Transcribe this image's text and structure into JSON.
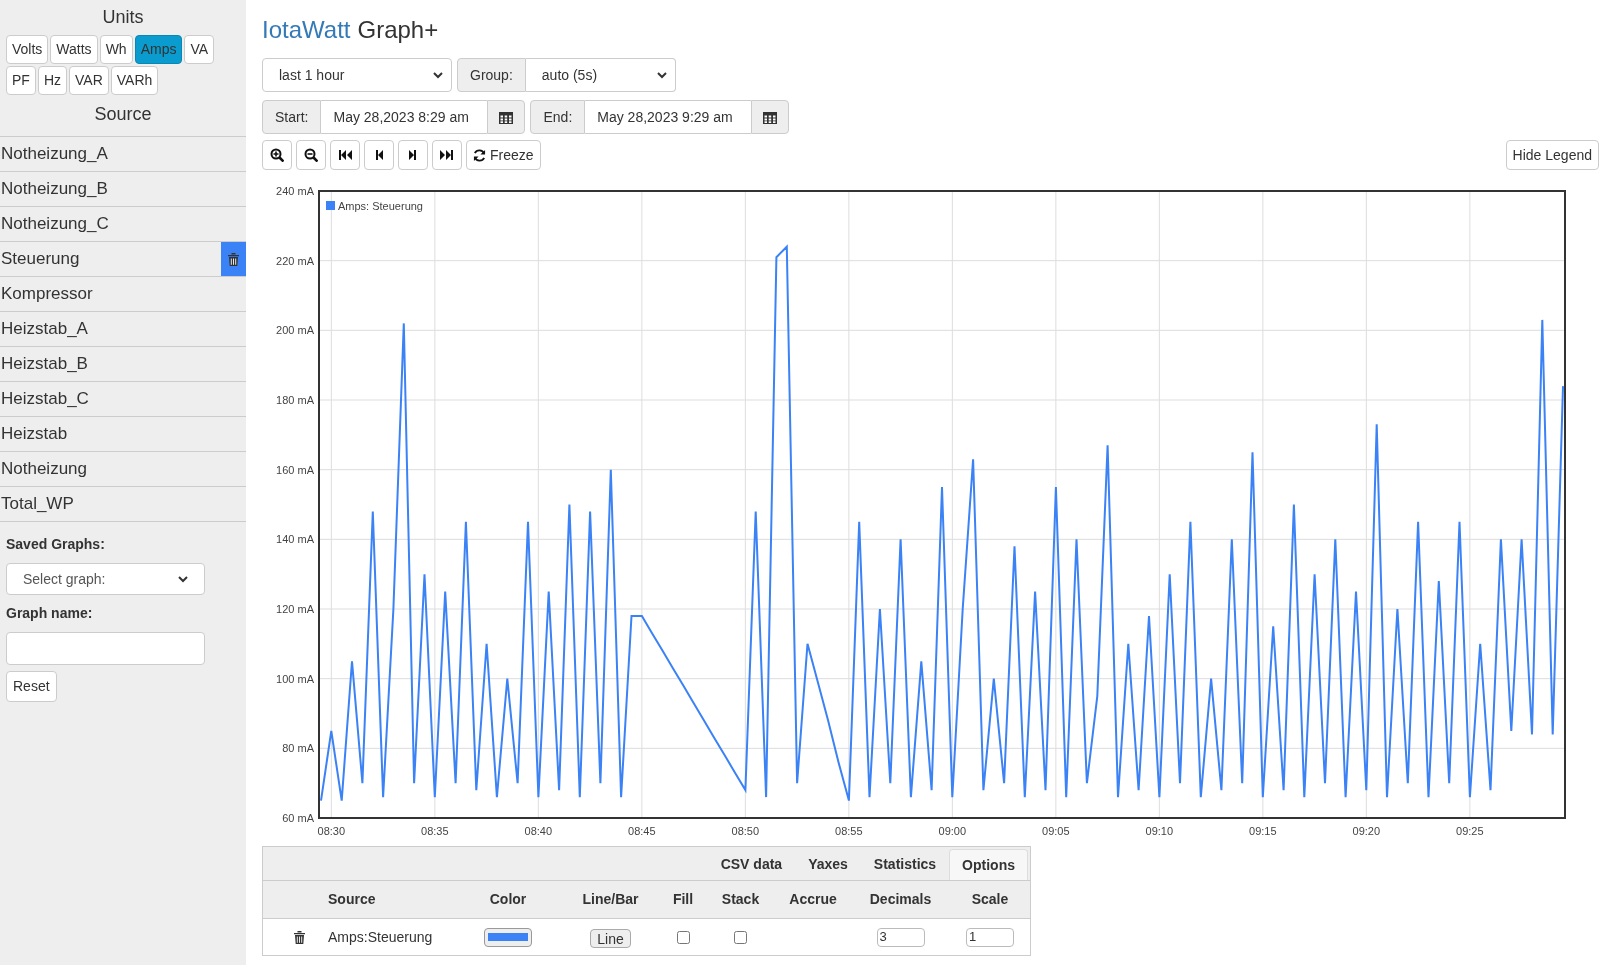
{
  "sidebar": {
    "units_title": "Units",
    "units": [
      {
        "label": "Volts",
        "selected": false
      },
      {
        "label": "Watts",
        "selected": false
      },
      {
        "label": "Wh",
        "selected": false
      },
      {
        "label": "Amps",
        "selected": true
      },
      {
        "label": "VA",
        "selected": false
      },
      {
        "label": "PF",
        "selected": false
      },
      {
        "label": "Hz",
        "selected": false
      },
      {
        "label": "VAR",
        "selected": false
      },
      {
        "label": "VARh",
        "selected": false
      }
    ],
    "source_title": "Source",
    "sources": [
      {
        "label": "Notheizung_A",
        "selected": false
      },
      {
        "label": "Notheizung_B",
        "selected": false
      },
      {
        "label": "Notheizung_C",
        "selected": false
      },
      {
        "label": "Steuerung",
        "selected": true
      },
      {
        "label": "Kompressor",
        "selected": false
      },
      {
        "label": "Heizstab_A",
        "selected": false
      },
      {
        "label": "Heizstab_B",
        "selected": false
      },
      {
        "label": "Heizstab_C",
        "selected": false
      },
      {
        "label": "Heizstab",
        "selected": false
      },
      {
        "label": "Notheizung",
        "selected": false
      },
      {
        "label": "Total_WP",
        "selected": false
      }
    ],
    "saved_graphs_label": "Saved Graphs:",
    "saved_graphs_select": "Select graph:",
    "graph_name_label": "Graph name:",
    "reset_button": "Reset"
  },
  "header": {
    "brand": "IotaWatt",
    "title": "Graph+"
  },
  "controls": {
    "period": "last 1 hour",
    "group_label": "Group:",
    "group": "auto (5s)",
    "start_label": "Start:",
    "start": "May 28,2023 8:29 am",
    "end_label": "End:",
    "end": "May 28,2023 9:29 am",
    "freeze_button": "Freeze",
    "legend_button": "Hide Legend"
  },
  "chart": {
    "chart_data": {
      "type": "line",
      "grid": true,
      "ylim": [
        60,
        240
      ],
      "yticks": [
        {
          "value": 60,
          "label": "60 mA"
        },
        {
          "value": 80,
          "label": "80 mA"
        },
        {
          "value": 100,
          "label": "100 mA"
        },
        {
          "value": 120,
          "label": "120 mA"
        },
        {
          "value": 140,
          "label": "140 mA"
        },
        {
          "value": 160,
          "label": "160 mA"
        },
        {
          "value": 180,
          "label": "180 mA"
        },
        {
          "value": 200,
          "label": "200 mA"
        },
        {
          "value": 220,
          "label": "220 mA"
        },
        {
          "value": 240,
          "label": "240 mA"
        }
      ],
      "categories": [
        null,
        "08:30",
        null,
        null,
        null,
        null,
        null,
        null,
        null,
        null,
        null,
        "08:35",
        null,
        null,
        null,
        null,
        null,
        null,
        null,
        null,
        null,
        "08:40",
        null,
        null,
        null,
        null,
        null,
        null,
        null,
        null,
        null,
        "08:45",
        null,
        null,
        null,
        null,
        null,
        null,
        null,
        null,
        null,
        "08:50",
        null,
        null,
        null,
        null,
        null,
        null,
        null,
        null,
        null,
        "08:55",
        null,
        null,
        null,
        null,
        null,
        null,
        null,
        null,
        null,
        "09:00",
        null,
        null,
        null,
        null,
        null,
        null,
        null,
        null,
        null,
        "09:05",
        null,
        null,
        null,
        null,
        null,
        null,
        null,
        null,
        null,
        "09:10",
        null,
        null,
        null,
        null,
        null,
        null,
        null,
        null,
        null,
        "09:15",
        null,
        null,
        null,
        null,
        null,
        null,
        null,
        null,
        null,
        "09:20",
        null,
        null,
        null,
        null,
        null,
        null,
        null,
        null,
        null,
        "09:25",
        null,
        null,
        null,
        null,
        null,
        null,
        null,
        null,
        null
      ],
      "series": [
        {
          "name": "Amps: Steuerung",
          "color": "#3b82f6",
          "values": [
            65,
            85,
            65,
            105,
            70,
            148,
            66,
            120,
            202,
            70,
            130,
            66,
            125,
            70,
            145,
            68,
            110,
            66,
            100,
            70,
            145,
            66,
            125,
            68,
            150,
            66,
            148,
            70,
            160,
            66,
            118,
            118,
            113,
            108,
            103,
            98,
            93,
            88,
            83,
            78,
            73,
            68,
            148,
            66,
            221,
            224,
            70,
            110,
            99,
            88,
            76,
            65,
            145,
            66,
            120,
            70,
            140,
            66,
            105,
            68,
            155,
            66,
            120,
            163,
            68,
            100,
            70,
            138,
            66,
            125,
            68,
            155,
            66,
            140,
            70,
            95,
            167,
            66,
            110,
            68,
            118,
            66,
            130,
            70,
            145,
            66,
            100,
            68,
            140,
            70,
            165,
            66,
            115,
            68,
            150,
            66,
            130,
            70,
            140,
            66,
            125,
            68,
            173,
            66,
            120,
            70,
            145,
            66,
            128,
            70,
            145,
            66,
            110,
            68,
            140,
            85,
            140,
            84,
            203,
            84,
            184
          ]
        }
      ]
    }
  },
  "table": {
    "tabs": [
      {
        "label": "CSV data",
        "selected": false
      },
      {
        "label": "Yaxes",
        "selected": false
      },
      {
        "label": "Statistics",
        "selected": false
      },
      {
        "label": "Options",
        "selected": true
      }
    ],
    "columns": [
      "Source",
      "Color",
      "Line/Bar",
      "Fill",
      "Stack",
      "Accrue",
      "Decimals",
      "Scale"
    ],
    "rows": [
      {
        "source": "Amps:Steuerung",
        "line_bar": "Line",
        "fill": false,
        "stack": false,
        "decimals": "3",
        "scale": "1"
      }
    ]
  }
}
